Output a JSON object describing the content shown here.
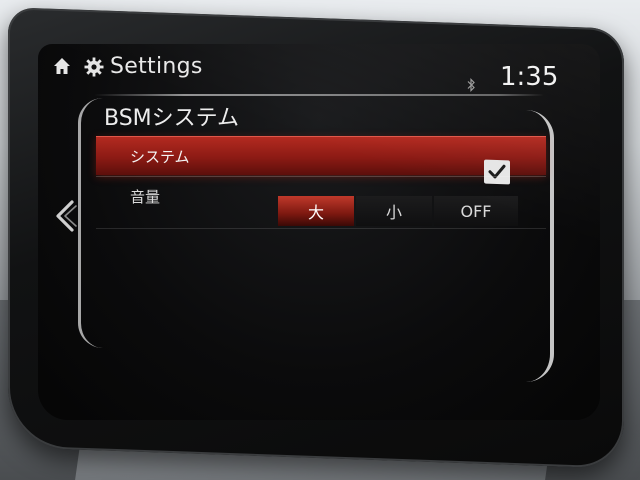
{
  "header": {
    "title": "Settings",
    "clock": "1:35",
    "icons": {
      "home": "home-icon",
      "settings": "gear-icon",
      "bluetooth": "bluetooth-icon"
    }
  },
  "section": {
    "title": "BSMシステム"
  },
  "rows": [
    {
      "label": "システム",
      "checked": true
    },
    {
      "label": "音量",
      "options": [
        "大",
        "小",
        "OFF"
      ],
      "selected": "大"
    }
  ],
  "nav": {
    "back_icon": "chevron-left-icon"
  },
  "colors": {
    "accent": "#b32a20",
    "text": "#e9e9e9",
    "background": "#0b0b0c"
  }
}
